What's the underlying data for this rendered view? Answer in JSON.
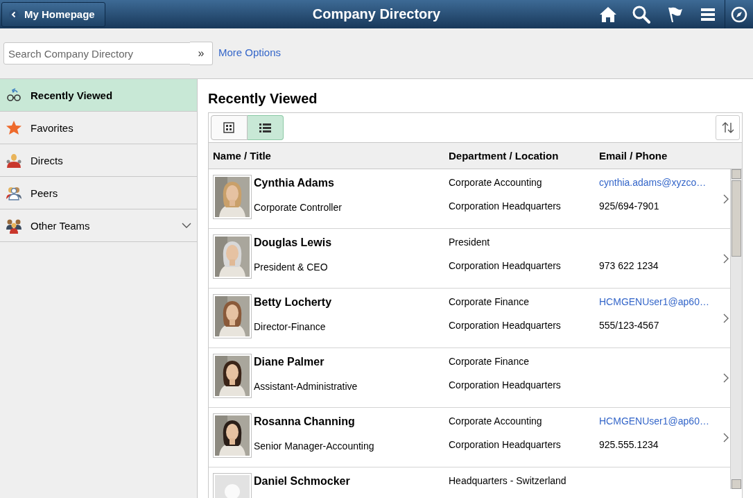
{
  "header": {
    "back_button": "My Homepage",
    "title": "Company Directory"
  },
  "search": {
    "placeholder": "Search Company Directory",
    "go_button": "»",
    "more_options": "More Options"
  },
  "sidebar": {
    "items": [
      {
        "label": "Recently Viewed",
        "kind": "item",
        "selected": true
      },
      {
        "label": "Favorites",
        "kind": "item",
        "selected": false
      },
      {
        "label": "Directs",
        "kind": "item",
        "selected": false
      },
      {
        "label": "Peers",
        "kind": "item",
        "selected": false
      },
      {
        "label": "Other Teams",
        "kind": "group",
        "selected": false
      }
    ]
  },
  "content": {
    "title": "Recently Viewed",
    "view_toggle": [
      {
        "kind": "grid",
        "selected": false
      },
      {
        "kind": "list",
        "selected": true
      }
    ],
    "table": {
      "columns": [
        "Name / Title",
        "Department / Location",
        "Email / Phone"
      ],
      "rows": [
        {
          "kind": "picture",
          "name": "Cynthia Adams",
          "title": "Corporate Controller",
          "department": "Corporate Accounting",
          "location": "Corporation Headquarters",
          "email": "cynthia.adams@xyzco…",
          "phone": "925/694-7901"
        },
        {
          "kind": "picture",
          "name": "Douglas Lewis",
          "title": "President & CEO",
          "department": "President",
          "location": "Corporation Headquarters",
          "phone": "973 622 1234"
        },
        {
          "kind": "picture",
          "name": "Betty Locherty",
          "title": "Director-Finance",
          "department": "Corporate Finance",
          "location": "Corporation Headquarters",
          "email": "HCMGENUser1@ap60…",
          "phone": "555/123-4567"
        },
        {
          "kind": "picture",
          "name": "Diane Palmer",
          "title": "Assistant-Administrative",
          "department": "Corporate Finance",
          "location": "Corporation Headquarters"
        },
        {
          "kind": "picture",
          "name": "Rosanna Channing",
          "title": "Senior Manager-Accounting",
          "department": "Corporate Accounting",
          "location": "Corporation Headquarters",
          "email": "HCMGENUser1@ap60…",
          "phone": "925.555.1234"
        },
        {
          "kind": "blank",
          "name": "Daniel Schmocker",
          "department": "Headquarters - Switzerland"
        }
      ]
    }
  }
}
